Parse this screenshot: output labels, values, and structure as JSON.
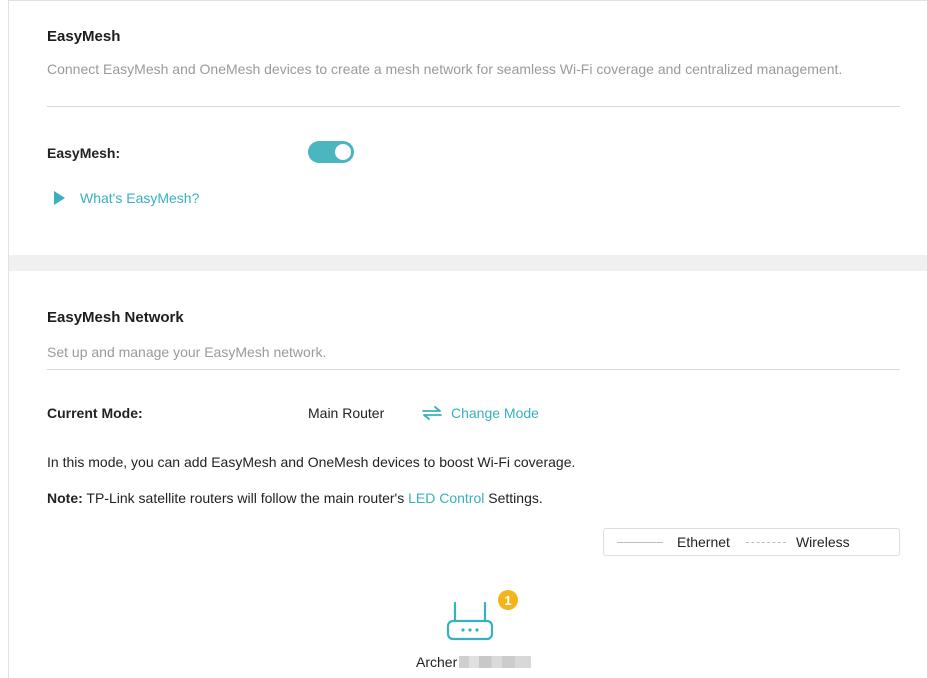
{
  "easymesh_section": {
    "title": "EasyMesh",
    "description": "Connect EasyMesh and OneMesh devices to create a mesh network for seamless Wi-Fi coverage and centralized management.",
    "toggle_label": "EasyMesh:",
    "toggle_state": "on",
    "whats_link": "What's EasyMesh?"
  },
  "network_section": {
    "title": "EasyMesh Network",
    "description": "Set up and manage your EasyMesh network.",
    "current_mode_label": "Current Mode:",
    "current_mode_value": "Main Router",
    "change_mode_label": "Change Mode",
    "info_text": "In this mode, you can add EasyMesh and OneMesh devices to boost Wi-Fi coverage.",
    "note_label": "Note:",
    "note_text_before": "TP-Link satellite routers will follow the main router's",
    "note_link": "LED Control",
    "note_text_after": "Settings.",
    "legend": {
      "ethernet": "Ethernet",
      "wireless": "Wireless"
    },
    "device": {
      "name": "Archer",
      "badge_count": "1",
      "icon": "router-icon"
    }
  },
  "colors": {
    "accent": "#37b0bf",
    "toggle_on": "#4bb6c0",
    "badge": "#f3b51c",
    "muted_text": "#9a9a9a",
    "section_gap": "#f0f0f0"
  }
}
